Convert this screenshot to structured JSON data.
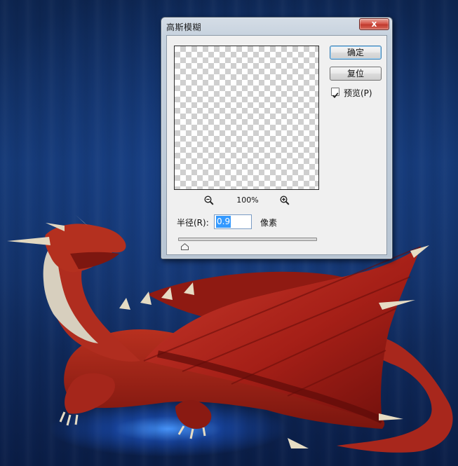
{
  "dialog": {
    "title": "高斯模糊",
    "close_label": "x",
    "ok_label": "确定",
    "reset_label": "复位",
    "preview_label": "预览(P)",
    "preview_checked": true,
    "zoom_level": "100%",
    "radius_label": "半径(R):",
    "radius_value": "0.9",
    "radius_unit": "像素",
    "slider_level_fraction": 0.02
  },
  "icons": {
    "zoom_out": "zoom-out-magnifier-icon",
    "zoom_in": "zoom-in-magnifier-icon",
    "checkmark": "checkmark-icon"
  },
  "colors": {
    "background": "#123066",
    "dragon": "#b5281e",
    "close_button": "#c0392e",
    "selection": "#3399ff"
  }
}
